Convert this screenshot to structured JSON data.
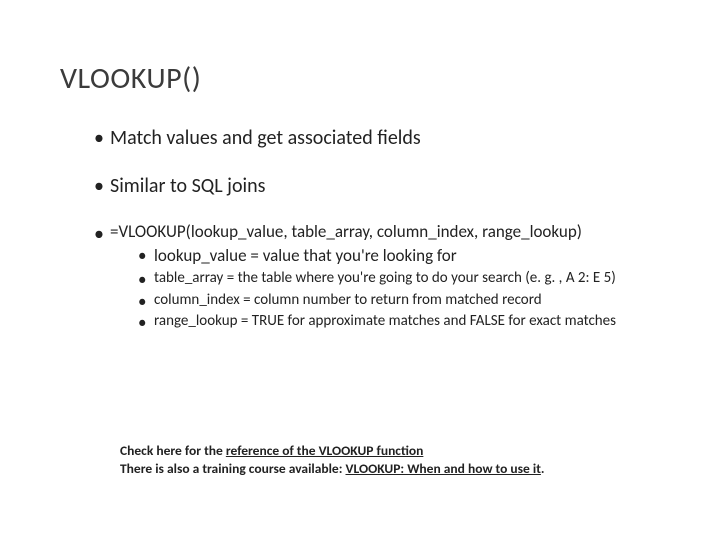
{
  "title": "VLOOKUP()",
  "bullets": {
    "b1": "Match values and get associated fields",
    "b2": "Similar to SQL joins",
    "b3": "=VLOOKUP(lookup_value, table_array, column_index, range_lookup)",
    "sub": {
      "s1": "lookup_value = value that you're looking for",
      "s2": "table_array = the table where you're going to do your search (e. g. , A 2: E 5)",
      "s3": "column_index = column number to return from matched record",
      "s4": "range_lookup = TRUE for approximate matches and FALSE for exact matches"
    }
  },
  "footnote": {
    "line1_pre": "Check here for the ",
    "line1_link": "reference of the VLOOKUP function",
    "line2_pre": "There is also a training course available: ",
    "line2_link": "VLOOKUP: When and how to use it",
    "period": "."
  }
}
